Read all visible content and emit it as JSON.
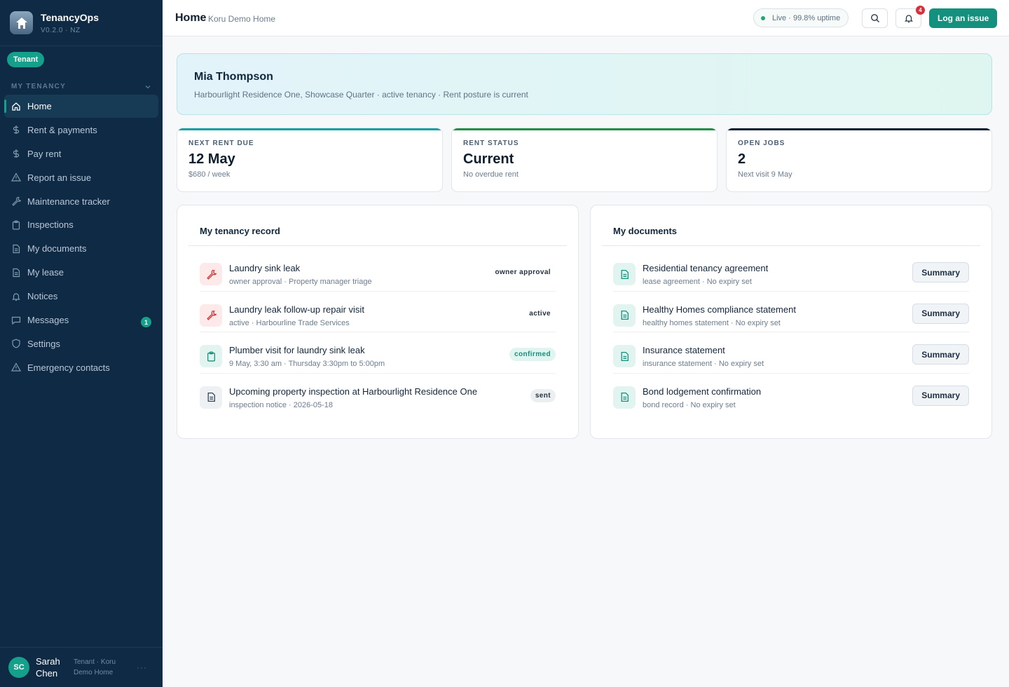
{
  "app": {
    "name": "TenancyOps",
    "version": "V0.2.0 · NZ",
    "role": "Tenant"
  },
  "sidebar": {
    "section_label": "MY TENANCY",
    "items": [
      {
        "label": "Home",
        "icon": "home-icon"
      },
      {
        "label": "Rent & payments",
        "icon": "dollar-icon"
      },
      {
        "label": "Pay rent",
        "icon": "dollar-icon"
      },
      {
        "label": "Report an issue",
        "icon": "warning-icon"
      },
      {
        "label": "Maintenance tracker",
        "icon": "wrench-icon"
      },
      {
        "label": "Inspections",
        "icon": "clipboard-icon"
      },
      {
        "label": "My documents",
        "icon": "document-icon"
      },
      {
        "label": "My lease",
        "icon": "document-icon"
      },
      {
        "label": "Notices",
        "icon": "bell-icon"
      },
      {
        "label": "Messages",
        "icon": "message-icon",
        "badge": "1"
      },
      {
        "label": "Settings",
        "icon": "shield-icon"
      },
      {
        "label": "Emergency contacts",
        "icon": "warning-icon"
      }
    ]
  },
  "user": {
    "initials": "SC",
    "name": "Sarah Chen",
    "meta": "Tenant · Koru Demo Home",
    "more": "···"
  },
  "header": {
    "title": "Home",
    "subtitle": "Koru Demo Home",
    "status": "Live · 99.8% uptime",
    "notification_count": "4",
    "primary_action": "Log an issue"
  },
  "hero": {
    "name": "Mia Thompson",
    "detail": "Harbourlight Residence One, Showcase Quarter · active tenancy · Rent posture is current"
  },
  "stats": [
    {
      "label": "NEXT RENT DUE",
      "value": "12 May",
      "sub": "$680 / week",
      "accent": "#14a0a0"
    },
    {
      "label": "RENT STATUS",
      "value": "Current",
      "sub": "No overdue rent",
      "accent": "#1f8f43"
    },
    {
      "label": "OPEN JOBS",
      "value": "2",
      "sub": "Next visit 9 May",
      "accent": "#0f1e2d"
    }
  ],
  "tenancy_record": {
    "title": "My tenancy record",
    "rows": [
      {
        "title": "Laundry sink leak",
        "sub": "owner approval · Property manager triage",
        "badge": "owner approval",
        "icon": "wrench-icon"
      },
      {
        "title": "Laundry leak follow-up repair visit",
        "sub": "active · Harbourline Trade Services",
        "badge": "active",
        "icon": "wrench-icon"
      },
      {
        "title": "Plumber visit for laundry sink leak",
        "sub": "9 May, 3:30 am · Thursday 3:30pm to 5:00pm",
        "badge": "confirmed",
        "icon": "clipboard-icon"
      },
      {
        "title": "Upcoming property inspection at Harbourlight Residence One",
        "sub": "inspection notice · 2026-05-18",
        "badge": "sent",
        "icon": "document-icon"
      }
    ]
  },
  "documents": {
    "title": "My documents",
    "button_label": "Summary",
    "rows": [
      {
        "title": "Residential tenancy agreement",
        "sub": "lease agreement · No expiry set"
      },
      {
        "title": "Healthy Homes compliance statement",
        "sub": "healthy homes statement · No expiry set"
      },
      {
        "title": "Insurance statement",
        "sub": "insurance statement · No expiry set"
      },
      {
        "title": "Bond lodgement confirmation",
        "sub": "bond record · No expiry set"
      }
    ]
  }
}
